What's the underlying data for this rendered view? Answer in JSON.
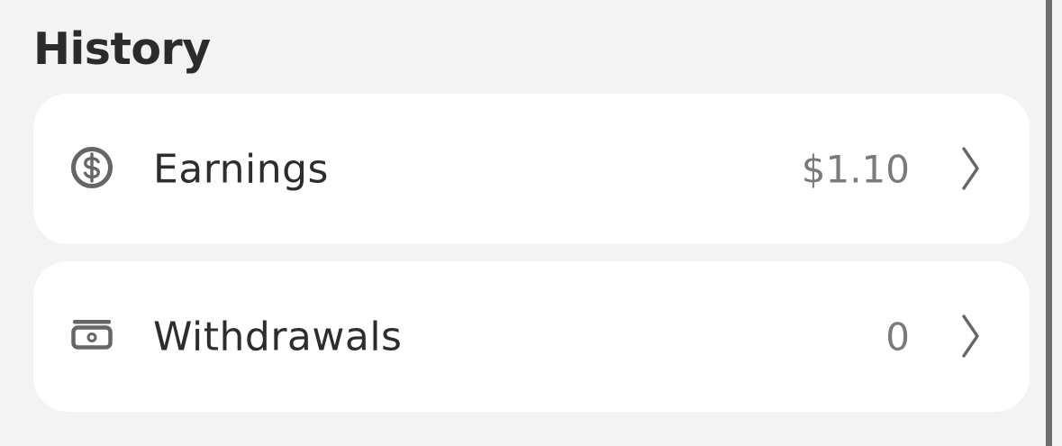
{
  "history": {
    "title": "History",
    "items": [
      {
        "label": "Earnings",
        "value": "$1.10",
        "icon": "dollar-circle-icon"
      },
      {
        "label": "Withdrawals",
        "value": "0",
        "icon": "cash-bill-icon"
      }
    ],
    "colors": {
      "background": "#f3f3f3",
      "card": "#ffffff",
      "text": "#2d2d2d",
      "muted": "#7a7a7a"
    }
  }
}
